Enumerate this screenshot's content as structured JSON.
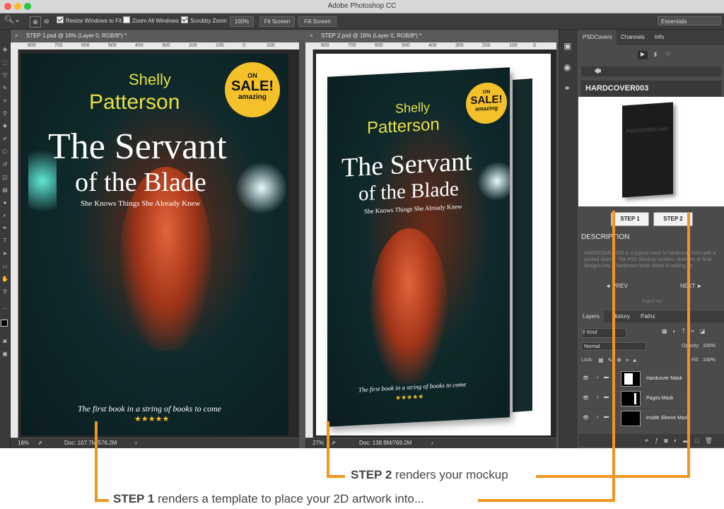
{
  "window": {
    "title": "Adobe Photoshop CC"
  },
  "options": {
    "resize_windows": "Resize Windows to Fit",
    "zoom_all": "Zoom All Windows",
    "scrubby_zoom": "Scrubby Zoom",
    "zoom_value": "100%",
    "fit_screen": "Fit Screen",
    "fill_screen": "Fill Screen",
    "workspace": "Essentials"
  },
  "documents": [
    {
      "tab": "STEP 1.psd @ 16% (Layer 0, RGB/8*) *",
      "zoom": "16%",
      "doc_info": "Doc: 107.7M/576.2M"
    },
    {
      "tab": "STEP 2.psd @ 16% (Layer 0, RGB/8*) *",
      "zoom": "27%",
      "doc_info": "Doc: 138.9M/769.2M"
    }
  ],
  "ruler_labels": [
    "800",
    "700",
    "600",
    "500",
    "400",
    "300",
    "200",
    "100",
    "0",
    "100",
    "200"
  ],
  "cover": {
    "author_first": "Shelly",
    "author_last": "Patterson",
    "title_line1": "The Servant",
    "title_line2": "of the Blade",
    "subtitle": "She Knows Things She Already Knew",
    "tagline": "The first book in a string of books to come",
    "stars": "★★★★★",
    "sale_top": "ON",
    "sale_main": "SALE!",
    "sale_bottom": "amazing"
  },
  "psdcovers": {
    "tabs": [
      "PSDCovers",
      "Channels",
      "Info"
    ],
    "product": "HARDCOVER003",
    "preview_watermark": "PSDCOVERS.com",
    "step1": "STEP 1",
    "step2": "STEP 2",
    "description_heading": "DESCRIPTION",
    "description_text": "HARDCOVER003 is a typical novel in hardcover form with a printed sleeve. The PSD Mockup renders sketches or final designs into a hardcover book which is waiting for",
    "prev": "◄ PREV",
    "next": "NEXT ►",
    "footer": "PsykIX Inc."
  },
  "layers": {
    "tabs": [
      "Layers",
      "History",
      "Paths"
    ],
    "filter": "Kind",
    "blend_mode": "Normal",
    "opacity_label": "Opacity:",
    "opacity": "100%",
    "lock_label": "Lock:",
    "fill_label": "Fill:",
    "fill": "100%",
    "items": [
      "Hardcover Mask",
      "Pages Mask",
      "Inside Sleeve Mask"
    ]
  },
  "captions": {
    "step2_bold": "STEP 2",
    "step2_rest": " renders your mockup",
    "step1_bold": "STEP 1",
    "step1_rest": " renders a template to place your 2D artwork into..."
  },
  "colors": {
    "accent_orange": "#f0951f",
    "author_yellow": "#e6e046",
    "sale_badge": "#f4c12a"
  }
}
